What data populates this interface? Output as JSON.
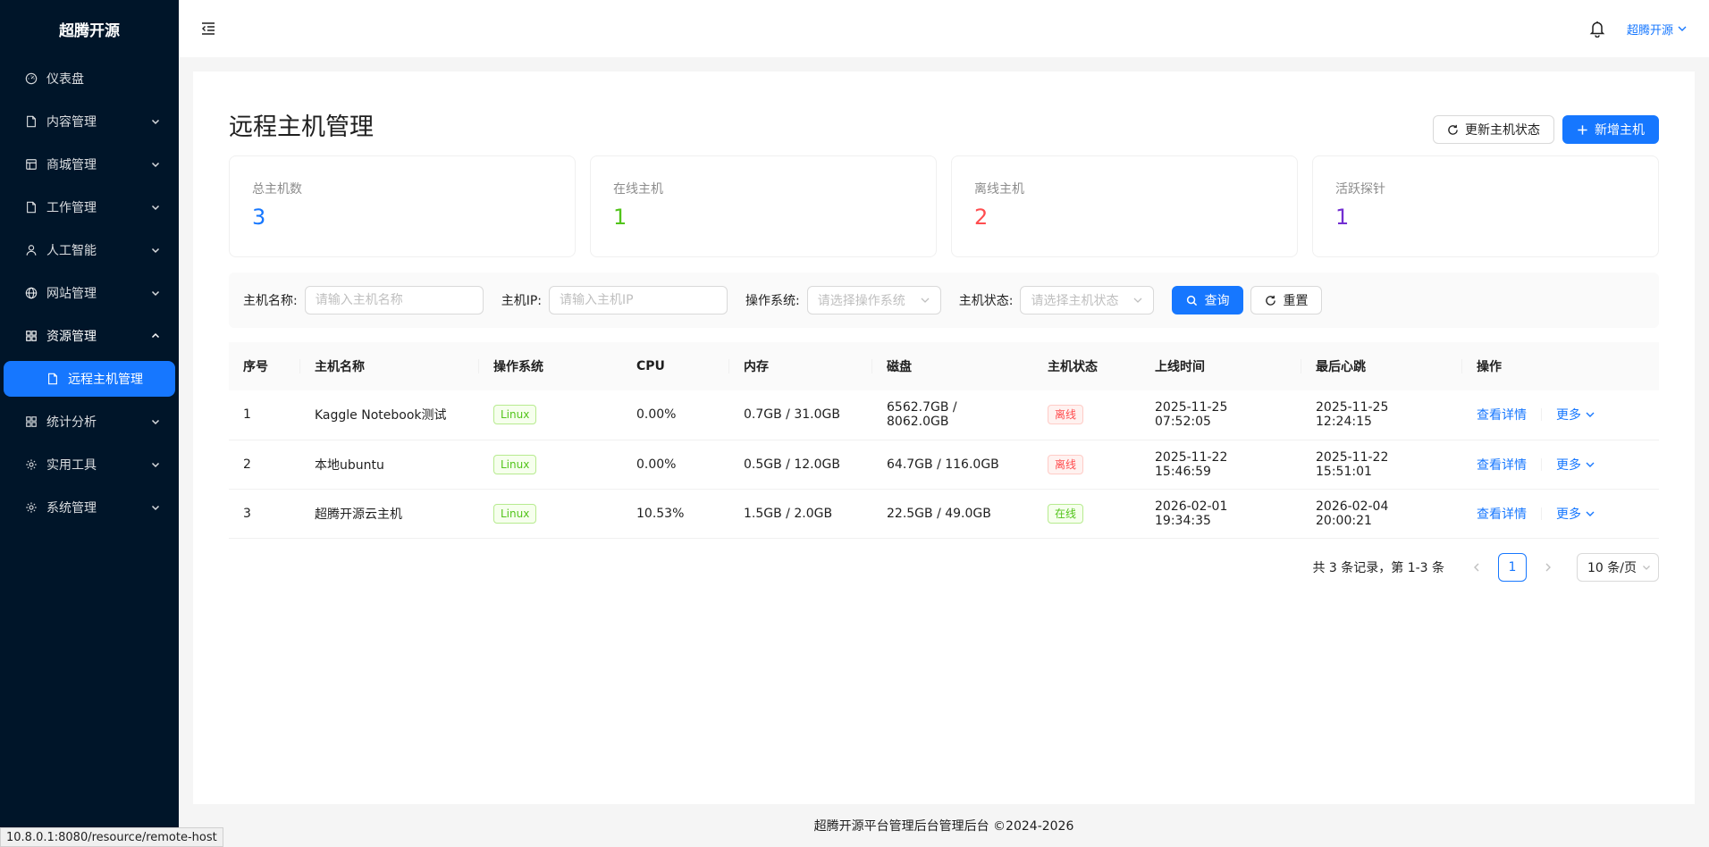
{
  "sidebar": {
    "logo": "超腾开源",
    "items": [
      {
        "label": "仪表盘",
        "icon": "dashboard-icon"
      },
      {
        "label": "内容管理",
        "icon": "file-icon"
      },
      {
        "label": "商城管理",
        "icon": "shop-icon"
      },
      {
        "label": "工作管理",
        "icon": "file-icon"
      },
      {
        "label": "人工智能",
        "icon": "user-icon"
      },
      {
        "label": "网站管理",
        "icon": "globe-icon"
      },
      {
        "label": "资源管理",
        "icon": "appstore-icon"
      },
      {
        "label": "统计分析",
        "icon": "appstore-icon"
      },
      {
        "label": "实用工具",
        "icon": "gear-icon"
      },
      {
        "label": "系统管理",
        "icon": "gear-icon"
      }
    ],
    "active_sub": "远程主机管理"
  },
  "header": {
    "user": "超腾开源"
  },
  "page": {
    "title": "远程主机管理",
    "refresh_label": "更新主机状态",
    "add_label": "新增主机"
  },
  "stats": [
    {
      "label": "总主机数",
      "value": "3",
      "color": "#1677ff"
    },
    {
      "label": "在线主机",
      "value": "1",
      "color": "#52c41a"
    },
    {
      "label": "离线主机",
      "value": "2",
      "color": "#ff4d4f"
    },
    {
      "label": "活跃探针",
      "value": "1",
      "color": "#722ed1"
    }
  ],
  "filter": {
    "name_label": "主机名称:",
    "name_placeholder": "请输入主机名称",
    "ip_label": "主机IP:",
    "ip_placeholder": "请输入主机IP",
    "os_label": "操作系统:",
    "os_placeholder": "请选择操作系统",
    "status_label": "主机状态:",
    "status_placeholder": "请选择主机状态",
    "search_label": "查询",
    "reset_label": "重置"
  },
  "table": {
    "headers": [
      "序号",
      "主机名称",
      "操作系统",
      "CPU",
      "内存",
      "磁盘",
      "主机状态",
      "上线时间",
      "最后心跳",
      "操作"
    ],
    "rows": [
      {
        "no": "1",
        "name": "Kaggle Notebook测试",
        "os": "Linux",
        "cpu": "0.00%",
        "mem": "0.7GB / 31.0GB",
        "disk": "6562.7GB / 8062.0GB",
        "status": "离线",
        "online": "2025-11-25 07:52:05",
        "heartbeat": "2025-11-25 12:24:15",
        "detail": "查看详情",
        "more": "更多"
      },
      {
        "no": "2",
        "name": "本地ubuntu",
        "os": "Linux",
        "cpu": "0.00%",
        "mem": "0.5GB / 12.0GB",
        "disk": "64.7GB / 116.0GB",
        "status": "离线",
        "online": "2025-11-22 15:46:59",
        "heartbeat": "2025-11-22 15:51:01",
        "detail": "查看详情",
        "more": "更多"
      },
      {
        "no": "3",
        "name": "超腾开源云主机",
        "os": "Linux",
        "cpu": "10.53%",
        "mem": "1.5GB / 2.0GB",
        "disk": "22.5GB / 49.0GB",
        "status": "在线",
        "online": "2026-02-01 19:34:35",
        "heartbeat": "2026-02-04 20:00:21",
        "detail": "查看详情",
        "more": "更多"
      }
    ]
  },
  "pagination": {
    "total_text": "共 3 条记录，第 1-3 条",
    "current": "1",
    "page_size": "10 条/页"
  },
  "footer": "超腾开源平台管理后台管理后台 ©2024-2026",
  "statusbar": "10.8.0.1:8080/resource/remote-host"
}
